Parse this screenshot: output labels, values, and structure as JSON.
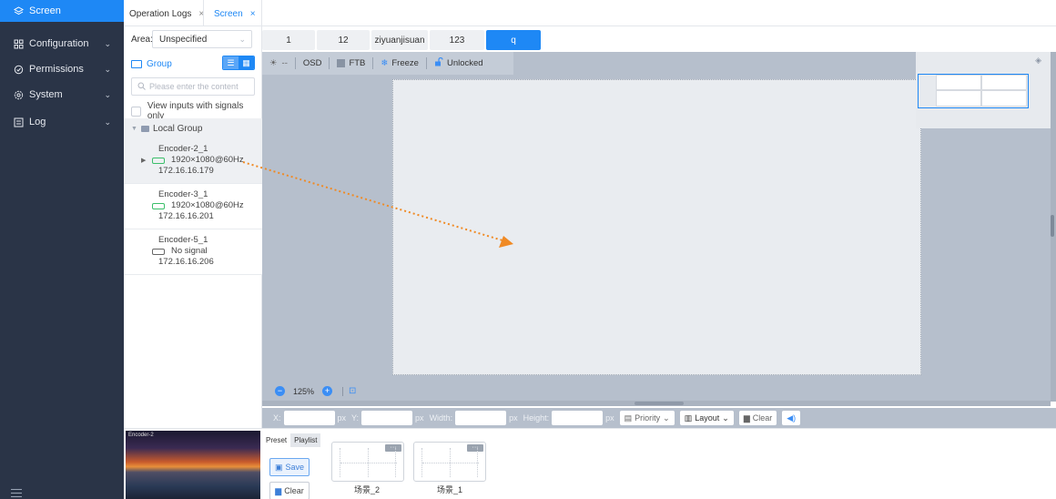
{
  "sidebar": {
    "items": [
      {
        "label": "Screen",
        "icon": "layers-icon"
      },
      {
        "label": "Configuration",
        "icon": "grid-icon"
      },
      {
        "label": "Permissions",
        "icon": "shield-icon"
      },
      {
        "label": "System",
        "icon": "gear-icon"
      },
      {
        "label": "Log",
        "icon": "log-icon"
      }
    ]
  },
  "top_tabs": [
    {
      "label": "Operation Logs",
      "close": "×"
    },
    {
      "label": "Screen",
      "close": "×"
    }
  ],
  "inputs_panel": {
    "area_label": "Area:",
    "area_value": "Unspecified",
    "group_label": "Group",
    "search_placeholder": "Please enter the content",
    "signals_only_label": "View inputs with signals only",
    "local_group_label": "Local Group",
    "encoders": [
      {
        "name": "Encoder-2_1",
        "resolution": "1920×1080@60Hz",
        "ip": "172.16.16.179",
        "signal": true
      },
      {
        "name": "Encoder-3_1",
        "resolution": "1920×1080@60Hz",
        "ip": "172.16.16.201",
        "signal": true
      },
      {
        "name": "Encoder-5_1",
        "resolution": "No signal",
        "ip": "172.16.16.206",
        "signal": false
      }
    ]
  },
  "layout_tabs": [
    "1",
    "12",
    "ziyuanjisuan",
    "123",
    "q"
  ],
  "toolbar": {
    "brightness": "--",
    "osd": "OSD",
    "ftb": "FTB",
    "freeze": "Freeze",
    "unlocked": "Unlocked"
  },
  "zoom": {
    "level": "125%"
  },
  "props": {
    "x_label": "X:",
    "y_label": "Y:",
    "width_label": "Width:",
    "height_label": "Height:",
    "unit": "px",
    "priority": "Priority",
    "layout": "Layout",
    "clear": "Clear"
  },
  "bottom": {
    "thumb_label": "Encoder-2",
    "preset_tab": "Preset",
    "playlist_tab": "Playlist",
    "save": "Save",
    "clear": "Clear",
    "scenes": [
      "场景_2",
      "场景_1"
    ],
    "scene_menu": "···"
  },
  "colors": {
    "accent": "#1e88f5",
    "sidebar": "#2a3447",
    "drag_arrow": "#f08a24"
  }
}
